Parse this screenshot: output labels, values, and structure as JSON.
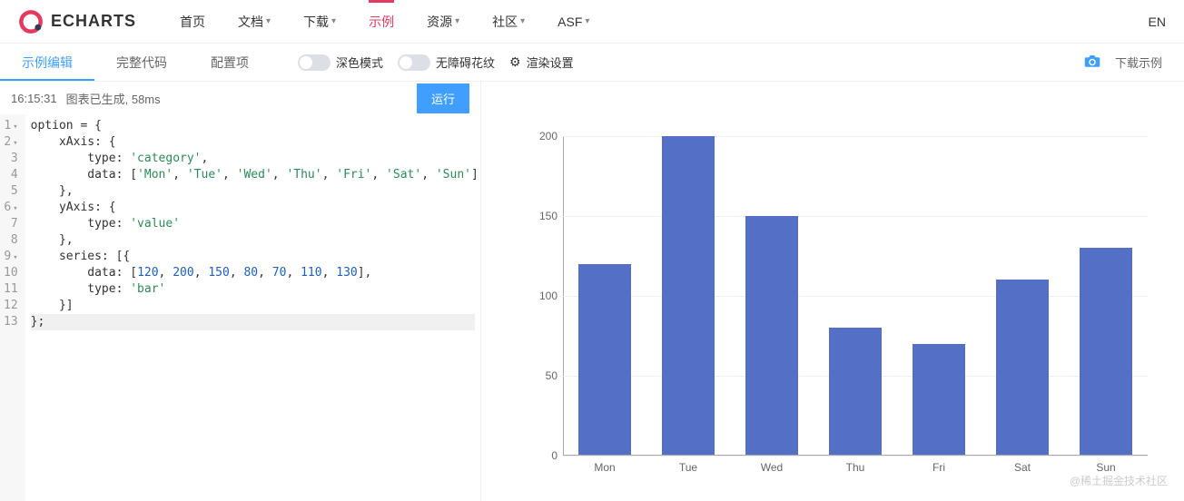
{
  "header": {
    "logo_text": "ECHARTS",
    "nav": [
      "首页",
      "文档",
      "下载",
      "示例",
      "资源",
      "社区",
      "ASF"
    ],
    "nav_active_index": 3,
    "nav_has_caret": [
      false,
      true,
      true,
      false,
      true,
      true,
      true
    ],
    "lang": "EN"
  },
  "subbar": {
    "tabs": [
      "示例编辑",
      "完整代码",
      "配置项"
    ],
    "active_tab": 0,
    "dark_mode_label": "深色模式",
    "pattern_label": "无障碍花纹",
    "render_label": "渲染设置",
    "download_label": "下载示例"
  },
  "status": {
    "time": "16:15:31",
    "msg": "图表已生成, 58ms",
    "run_label": "运行"
  },
  "code_lines": [
    "option = {",
    "    xAxis: {",
    "        type: 'category',",
    "        data: ['Mon', 'Tue', 'Wed', 'Thu', 'Fri', 'Sat', 'Sun']",
    "    },",
    "    yAxis: {",
    "        type: 'value'",
    "    },",
    "    series: [{",
    "        data: [120, 200, 150, 80, 70, 110, 130],",
    "        type: 'bar'",
    "    }]",
    "};"
  ],
  "chart_data": {
    "type": "bar",
    "categories": [
      "Mon",
      "Tue",
      "Wed",
      "Thu",
      "Fri",
      "Sat",
      "Sun"
    ],
    "values": [
      120,
      200,
      150,
      80,
      70,
      110,
      130
    ],
    "ylim": [
      0,
      200
    ],
    "y_ticks": [
      0,
      50,
      100,
      150,
      200
    ],
    "title": "",
    "xlabel": "",
    "ylabel": ""
  },
  "watermark": "@稀土掘金技术社区",
  "colors": {
    "accent": "#e43961",
    "primary": "#409eff",
    "bar": "#5470c6"
  }
}
